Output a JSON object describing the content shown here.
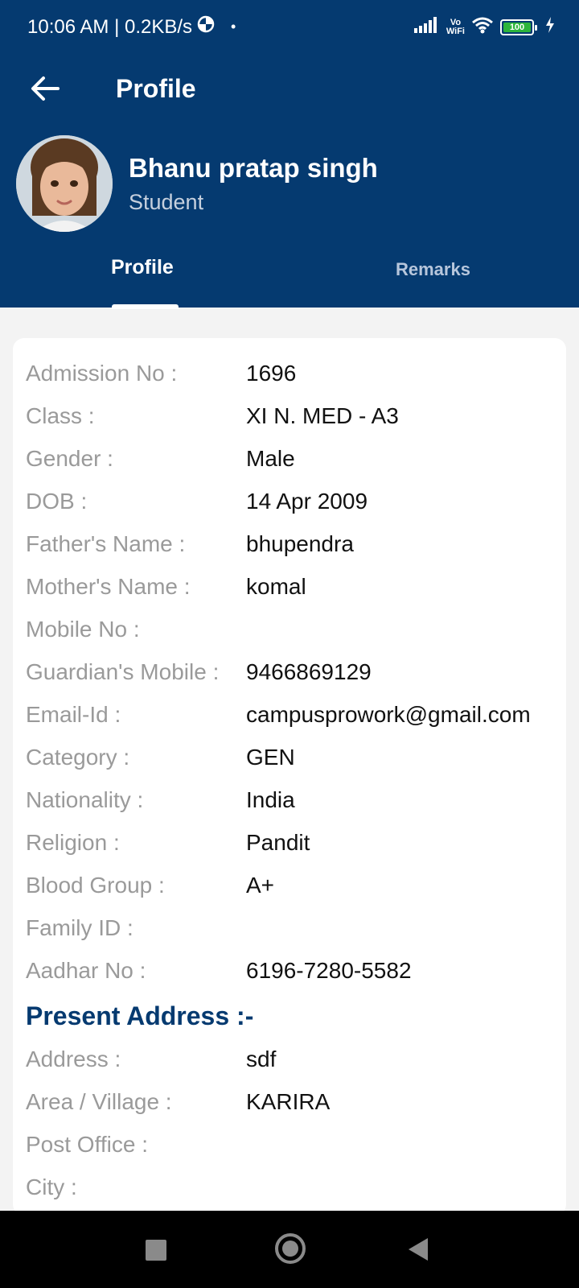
{
  "status_bar": {
    "time_speed": "10:06 AM | 0.2KB/s",
    "dot": "•",
    "vo": "Vo",
    "wifi": "WiFi",
    "battery": "100"
  },
  "appbar": {
    "title": "Profile"
  },
  "profile": {
    "name": "Bhanu pratap singh",
    "role": "Student"
  },
  "tabs": [
    {
      "label": "Profile",
      "active": true
    },
    {
      "label": "Remarks",
      "active": false
    }
  ],
  "details": [
    {
      "label": "Admission No :",
      "value": "1696"
    },
    {
      "label": "Class :",
      "value": "XI N. MED - A3"
    },
    {
      "label": "Gender :",
      "value": "Male"
    },
    {
      "label": "DOB :",
      "value": "14 Apr 2009"
    },
    {
      "label": "Father's Name :",
      "value": "bhupendra"
    },
    {
      "label": "Mother's Name :",
      "value": "komal"
    },
    {
      "label": "Mobile No :",
      "value": ""
    },
    {
      "label": "Guardian's Mobile :",
      "value": "9466869129"
    },
    {
      "label": "Email-Id :",
      "value": "campusprowork@gmail.com"
    },
    {
      "label": "Category :",
      "value": "GEN"
    },
    {
      "label": "Nationality :",
      "value": "India"
    },
    {
      "label": "Religion :",
      "value": "Pandit"
    },
    {
      "label": "Blood Group :",
      "value": "A+"
    },
    {
      "label": "Family ID :",
      "value": ""
    },
    {
      "label": "Aadhar No :",
      "value": "6196-7280-5582"
    }
  ],
  "present_address": {
    "title": "Present Address :-",
    "rows": [
      {
        "label": "Address :",
        "value": "sdf"
      },
      {
        "label": "Area / Village :",
        "value": "KARIRA"
      },
      {
        "label": "Post Office :",
        "value": ""
      },
      {
        "label": "City :",
        "value": ""
      }
    ]
  },
  "colors": {
    "primary": "#053a70",
    "label_gray": "#9a9a9a",
    "value_black": "#111111",
    "background": "#f3f3f3"
  }
}
